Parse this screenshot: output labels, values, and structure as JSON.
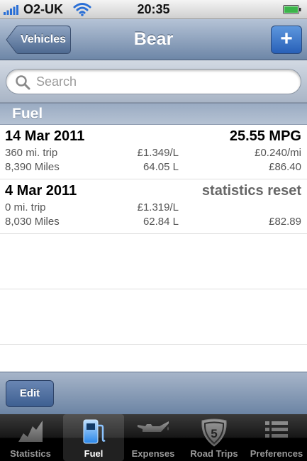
{
  "status": {
    "carrier": "O2-UK",
    "time": "20:35"
  },
  "nav": {
    "back_label": "Vehicles",
    "title": "Bear",
    "add_label": "+"
  },
  "search": {
    "placeholder": "Search"
  },
  "section": {
    "title": "Fuel"
  },
  "entries": [
    {
      "date": "14 Mar 2011",
      "headline": "25.55 MPG",
      "trip": "360 mi. trip",
      "price_per_litre": "£1.349/L",
      "cost_per_mile": "£0.240/mi",
      "odometer": "8,390 Miles",
      "volume": "64.05 L",
      "total": "£86.40"
    },
    {
      "date": "4 Mar 2011",
      "headline": "statistics reset",
      "trip": "0 mi. trip",
      "price_per_litre": "£1.319/L",
      "cost_per_mile": "",
      "odometer": "8,030 Miles",
      "volume": "62.84 L",
      "total": "£82.89"
    }
  ],
  "toolbar": {
    "edit_label": "Edit"
  },
  "tabs": [
    {
      "label": "Statistics",
      "icon": "statistics-icon"
    },
    {
      "label": "Fuel",
      "icon": "fuel-pump-icon",
      "selected": true
    },
    {
      "label": "Expenses",
      "icon": "oil-can-icon"
    },
    {
      "label": "Road Trips",
      "icon": "highway-sign-icon",
      "badge": "5"
    },
    {
      "label": "Preferences",
      "icon": "list-icon"
    }
  ],
  "colors": {
    "nav_bar": "#7a90b0",
    "section_header": "#a8b6ca",
    "add_button": "#3b73c9",
    "tab_bar": "#000000"
  }
}
